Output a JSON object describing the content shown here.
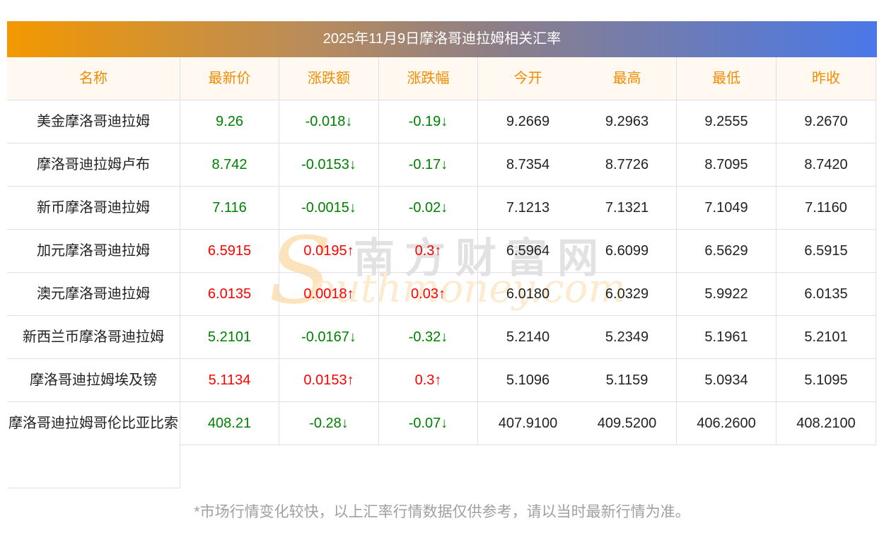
{
  "title": "2025年11月9日摩洛哥迪拉姆相关汇率",
  "headers": [
    "名称",
    "最新价",
    "涨跌额",
    "涨跌幅",
    "今开",
    "最高",
    "最低",
    "昨收"
  ],
  "rows": [
    {
      "name": "美金摩洛哥迪拉姆",
      "price": "9.26",
      "change": "-0.018↓",
      "pct": "-0.19↓",
      "open": "9.2669",
      "high": "9.2963",
      "low": "9.2555",
      "prev": "9.2670",
      "dir": "down"
    },
    {
      "name": "摩洛哥迪拉姆卢布",
      "price": "8.742",
      "change": "-0.0153↓",
      "pct": "-0.17↓",
      "open": "8.7354",
      "high": "8.7726",
      "low": "8.7095",
      "prev": "8.7420",
      "dir": "down"
    },
    {
      "name": "新币摩洛哥迪拉姆",
      "price": "7.116",
      "change": "-0.0015↓",
      "pct": "-0.02↓",
      "open": "7.1213",
      "high": "7.1321",
      "low": "7.1049",
      "prev": "7.1160",
      "dir": "down"
    },
    {
      "name": "加元摩洛哥迪拉姆",
      "price": "6.5915",
      "change": "0.0195↑",
      "pct": "0.3↑",
      "open": "6.5964",
      "high": "6.6099",
      "low": "6.5629",
      "prev": "6.5915",
      "dir": "up"
    },
    {
      "name": "澳元摩洛哥迪拉姆",
      "price": "6.0135",
      "change": "0.0018↑",
      "pct": "0.03↑",
      "open": "6.0180",
      "high": "6.0329",
      "low": "5.9922",
      "prev": "6.0135",
      "dir": "up"
    },
    {
      "name": "新西兰币摩洛哥迪拉姆",
      "price": "5.2101",
      "change": "-0.0167↓",
      "pct": "-0.32↓",
      "open": "5.2140",
      "high": "5.2349",
      "low": "5.1961",
      "prev": "5.2101",
      "dir": "down"
    },
    {
      "name": "摩洛哥迪拉姆埃及镑",
      "price": "5.1134",
      "change": "0.0153↑",
      "pct": "0.3↑",
      "open": "5.1096",
      "high": "5.1159",
      "low": "5.0934",
      "prev": "5.1095",
      "dir": "up"
    },
    {
      "name": "摩洛哥迪拉姆哥伦比亚比索",
      "price": "408.21",
      "change": "-0.28↓",
      "pct": "-0.07↓",
      "open": "407.9100",
      "high": "409.5200",
      "low": "406.2600",
      "prev": "408.2100",
      "dir": "down"
    }
  ],
  "watermark": {
    "cn": "南方财富网",
    "en": "southmoney.com"
  },
  "footer": "*市场行情变化较快，以上汇率行情数据仅供参考，请以当时最新行情为准。"
}
